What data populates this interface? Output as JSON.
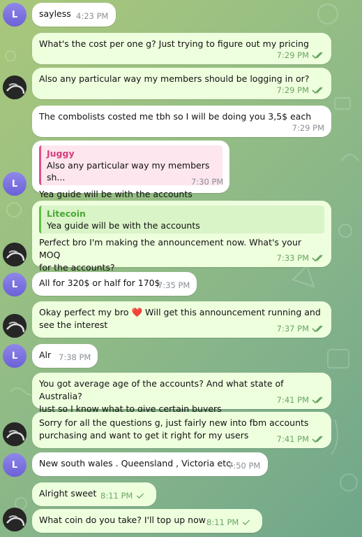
{
  "contacts": {
    "seller": {
      "name": "Juggy",
      "avatar_letter": "L"
    },
    "buyer": {
      "name": "Litecoin"
    }
  },
  "messages": [
    {
      "id": 1,
      "side": "in",
      "text": "sayless",
      "time": "4:23 PM"
    },
    {
      "id": 2,
      "side": "out",
      "text": "What's the cost per one g? Just trying to figure out my pricing",
      "time": "7:29 PM",
      "status": "read"
    },
    {
      "id": 3,
      "side": "out",
      "text": "Also any particular way my members should be logging in or?",
      "time": "7:29 PM",
      "status": "read"
    },
    {
      "id": 4,
      "side": "in",
      "text": "The combolists costed me tbh so I will be doing you 3,5$ each",
      "time": "7:29 PM"
    },
    {
      "id": 5,
      "side": "in",
      "reply_to": {
        "name": "Juggy",
        "text": "Also any particular way my members sh..."
      },
      "text": "Yea guide will be with the accounts",
      "time": "7:30 PM"
    },
    {
      "id": 6,
      "side": "out",
      "reply_to": {
        "name": "Litecoin",
        "text": "Yea guide will be with the accounts"
      },
      "text_line1": "Perfect bro I'm making the announcement now. What's your MOQ",
      "text_line2": "for the accounts?",
      "time": "7:33 PM",
      "status": "read"
    },
    {
      "id": 7,
      "side": "in",
      "text": "All for 320$ or half for 170$",
      "time": "7:35 PM"
    },
    {
      "id": 8,
      "side": "out",
      "text_pre": "Okay perfect my bro",
      "emoji": "❤️",
      "text_post": "Will get this announcement running and",
      "text_line2": "see the interest",
      "time": "7:37 PM",
      "status": "read"
    },
    {
      "id": 9,
      "side": "in",
      "text": "Alr",
      "time": "7:38 PM"
    },
    {
      "id": 10,
      "side": "out",
      "text_line1": "You got average age of the accounts? And what state of Australia?",
      "text_line2": "Just so I know what to give certain buyers",
      "time": "7:41 PM",
      "status": "read"
    },
    {
      "id": 11,
      "side": "out",
      "text_line1": "Sorry for all the questions g, just fairly new into fbm accounts",
      "text_line2": "purchasing and want to get it right for my users",
      "time": "7:41 PM",
      "status": "read"
    },
    {
      "id": 12,
      "side": "in",
      "text": "New south wales . Queensland , Victoria etc.",
      "time": "7:50 PM"
    },
    {
      "id": 13,
      "side": "out",
      "text": "Alright sweet",
      "time": "8:11 PM",
      "status": "sent"
    },
    {
      "id": 14,
      "side": "out",
      "text": "What coin do you take? I'll top up now",
      "time": "8:11 PM",
      "status": "sent"
    }
  ],
  "colors": {
    "incoming_bubble": "#ffffff",
    "outgoing_bubble": "#eeffde",
    "read_check": "#6aa564",
    "avatar_letter_bg": "#7b70e0",
    "reply_pink": "#e0508a",
    "reply_green": "#5fbf4a"
  },
  "icons": {
    "read_status": "double-check-icon",
    "sent_status": "single-check-icon"
  }
}
